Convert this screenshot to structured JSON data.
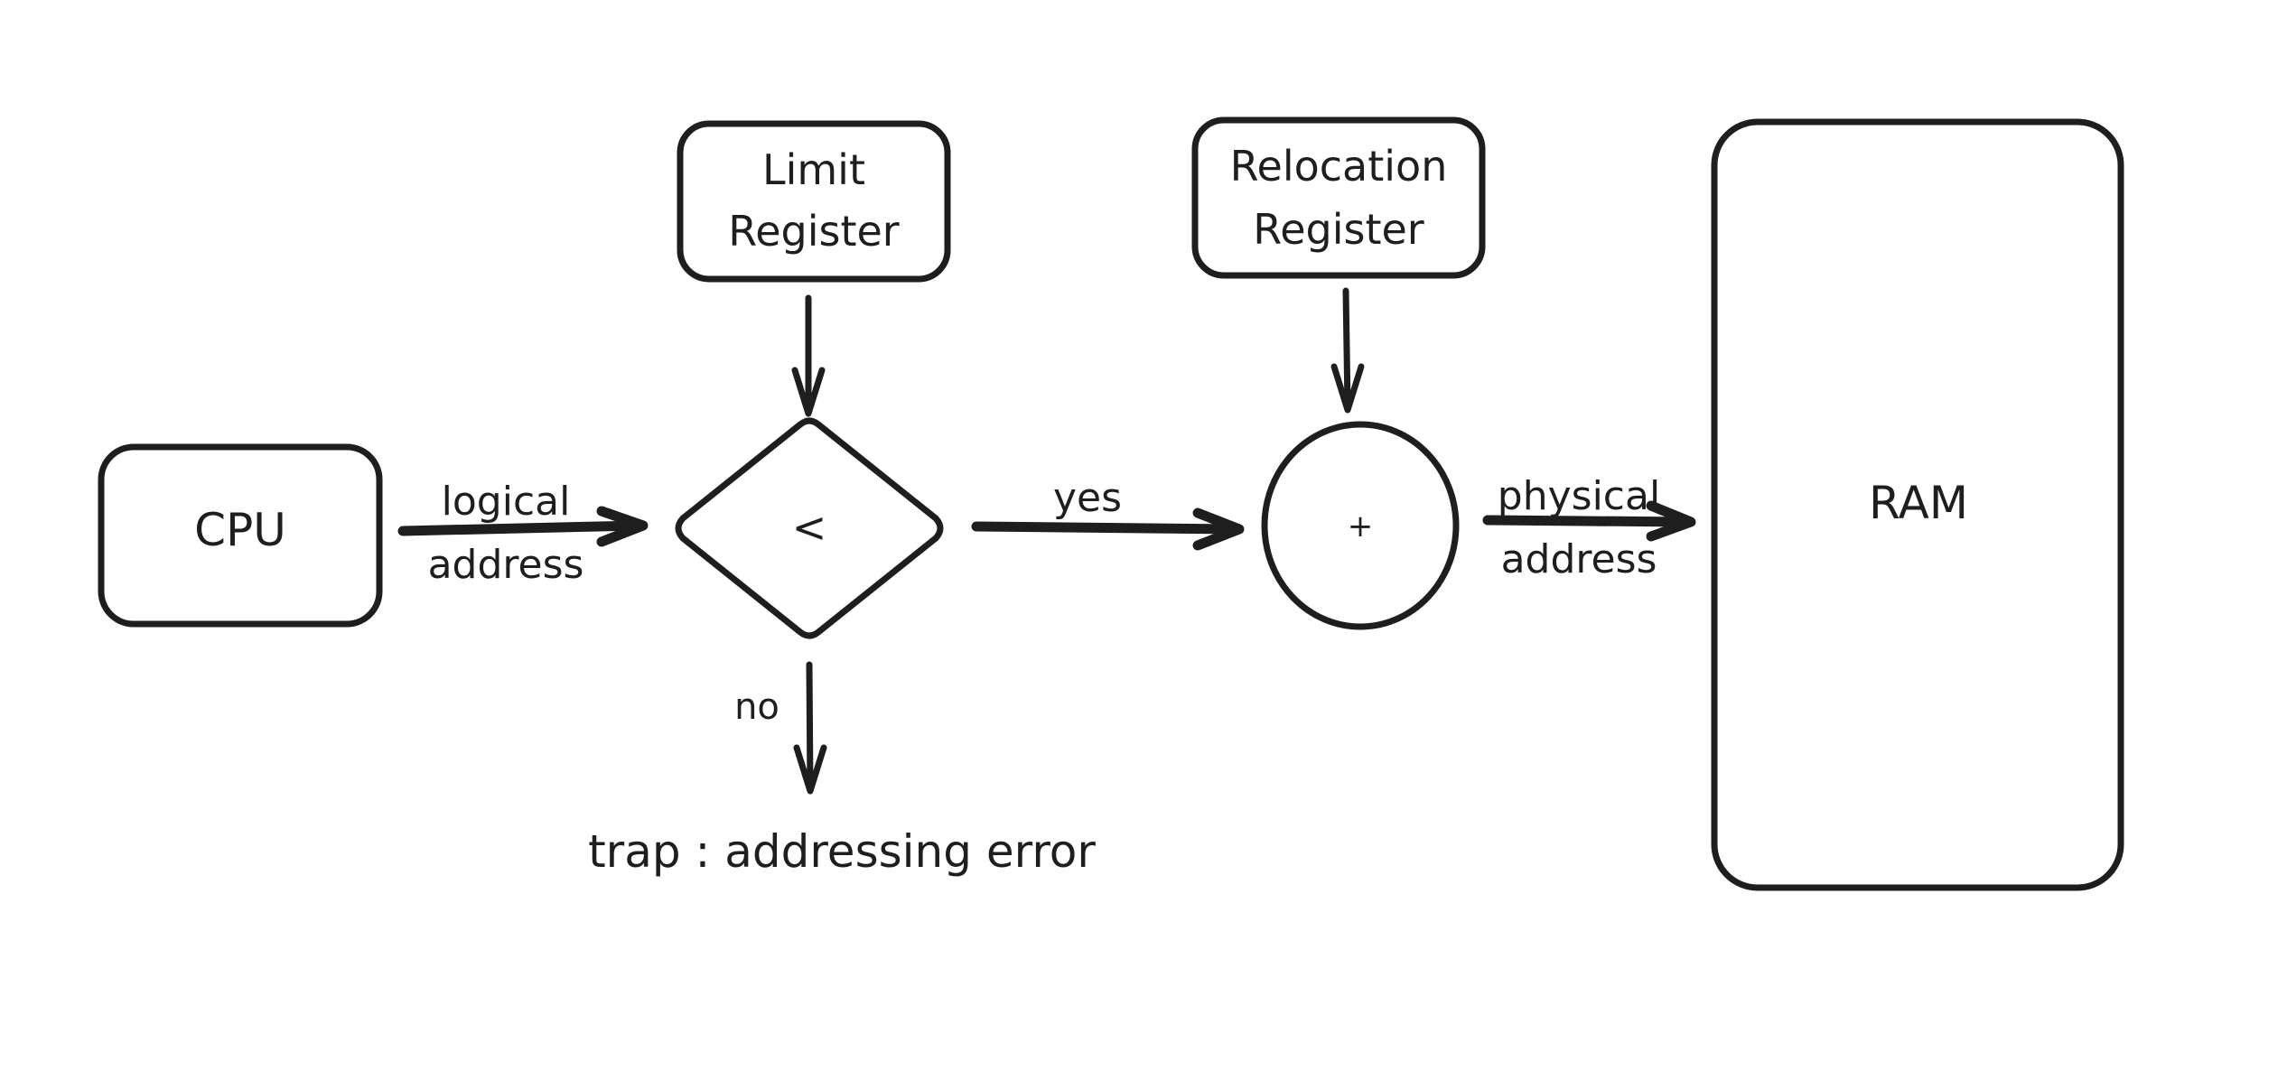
{
  "diagram": {
    "nodes": {
      "cpu": {
        "label": "CPU"
      },
      "limit_register": {
        "line1": "Limit",
        "line2": "Register"
      },
      "comparator": {
        "label": "<"
      },
      "relocation_register": {
        "line1": "Relocation",
        "line2": "Register"
      },
      "adder": {
        "label": "+"
      },
      "ram": {
        "label": "RAM"
      },
      "trap": {
        "label": "trap : addressing error"
      }
    },
    "edges": {
      "logical": {
        "line1": "logical",
        "line2": "address"
      },
      "yes": {
        "label": "yes"
      },
      "no": {
        "label": "no"
      },
      "physical": {
        "line1": "physical",
        "line2": "address"
      }
    },
    "colors": {
      "stroke": "#1e1e1e",
      "background": "#ffffff"
    }
  }
}
